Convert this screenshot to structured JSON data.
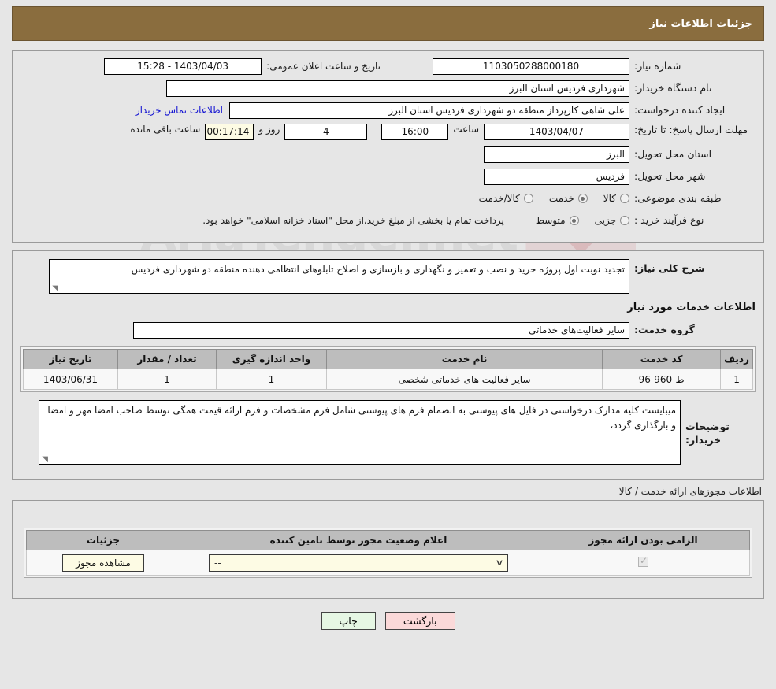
{
  "header": {
    "title": "جزئیات اطلاعات نیاز"
  },
  "form": {
    "need_number_label": "شماره نیاز:",
    "need_number_value": "1103050288000180",
    "announce_label": "تاریخ و ساعت اعلان عمومی:",
    "announce_value": "1403/04/03 - 15:28",
    "buyer_org_label": "نام دستگاه خریدار:",
    "buyer_org_value": "شهرداری فردیس استان البرز",
    "creator_label": "ایجاد کننده درخواست:",
    "creator_value": "علی شاهی کارپرداز منطقه دو شهرداری فردیس استان البرز",
    "contact_link": "اطلاعات تماس خریدار",
    "deadline_label": "مهلت ارسال پاسخ: تا تاریخ:",
    "deadline_date": "1403/04/07",
    "hour_label": "ساعت",
    "deadline_time": "16:00",
    "days_remaining": "4",
    "days_word": "روز و",
    "countdown": "00:17:14",
    "remaining_word": "ساعت باقی مانده",
    "province_label": "استان محل تحویل:",
    "province_value": "البرز",
    "city_label": "شهر محل تحویل:",
    "city_value": "فردیس",
    "category_label": "طبقه بندی موضوعی:",
    "category_options": [
      {
        "label": "کالا",
        "selected": false
      },
      {
        "label": "خدمت",
        "selected": true
      },
      {
        "label": "کالا/خدمت",
        "selected": false
      }
    ],
    "process_label": "نوع فرآیند خرید :",
    "process_options": [
      {
        "label": "جزیی",
        "selected": false
      },
      {
        "label": "متوسط",
        "selected": true
      }
    ],
    "process_note": "پرداخت تمام یا بخشی از مبلغ خرید،از محل \"اسناد خزانه اسلامی\" خواهد بود."
  },
  "description": {
    "label": "شرح کلی نیاز:",
    "value": "تجدید نوبت اول پروژه خرید و نصب و تعمیر و نگهداری و بازسازی و اصلاح تابلوهای انتظامی دهنده منطقه دو شهرداری فردیس"
  },
  "services": {
    "section_title": "اطلاعات خدمات مورد نیاز",
    "group_label": "گروه خدمت:",
    "group_value": "سایر فعالیت‌های خدماتی",
    "columns": [
      "ردیف",
      "کد خدمت",
      "نام خدمت",
      "واحد اندازه گیری",
      "تعداد / مقدار",
      "تاریخ نیاز"
    ],
    "rows": [
      {
        "index": "1",
        "code": "ط-960-96",
        "name": "سایر فعالیت های خدماتی شخصی",
        "unit": "1",
        "quantity": "1",
        "date": "1403/06/31"
      }
    ]
  },
  "buyer_notes": {
    "label": "توضیحات خریدار:",
    "value": "میبایست کلیه مدارک درخواستی در فایل های پیوستی به انضمام فرم های پیوستی شامل فرم مشخصات و فرم ارائه قیمت همگی توسط صاحب امضا مهر و امضا و بارگذاری گردد،"
  },
  "permits": {
    "outer_label": "اطلاعات مجوزهای ارائه خدمت / کالا",
    "columns": [
      "الزامی بودن ارائه مجوز",
      "اعلام وضعیت مجوز توسط تامین کننده",
      "جزئیات"
    ],
    "rows": [
      {
        "required": true,
        "status_value": "--",
        "details_button": "مشاهده مجوز"
      }
    ]
  },
  "footer": {
    "print_label": "چاپ",
    "back_label": "بازگشت"
  },
  "watermark": {
    "text": "AriaTender.net"
  },
  "colors": {
    "header_brown": "#8a6d3e",
    "link_blue": "#1414d2",
    "cream": "#fdfbe4",
    "print_green": "#e6f7e4",
    "back_pink": "#fbd9d9",
    "table_header_gray": "#bdbdbd"
  }
}
